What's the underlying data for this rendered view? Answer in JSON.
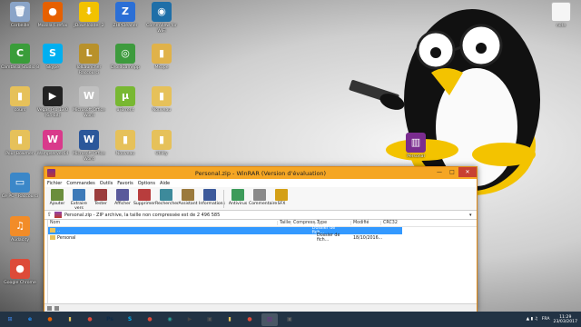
{
  "desktop": {
    "icons": [
      {
        "label": "Corbeille",
        "color": "#8aa4c8",
        "glyph": "🗑",
        "icon": "recycle-bin-icon"
      },
      {
        "label": "Mozilla Firefox",
        "color": "#e66000",
        "glyph": "●",
        "icon": "firefox-icon"
      },
      {
        "label": "JDownloader 2",
        "color": "#f2c200",
        "glyph": "⬇",
        "icon": "jdownloader-icon"
      },
      {
        "label": "ZHPCleaner",
        "color": "#2b6fd6",
        "glyph": "Z",
        "icon": "zhpcleaner-icon"
      },
      {
        "label": "CommView for WiFi",
        "color": "#1f6fa8",
        "glyph": "◉",
        "icon": "commview-icon"
      },
      {
        "label": "Camtasia Studio 8",
        "color": "#3a9d3a",
        "glyph": "C",
        "icon": "camtasia-icon"
      },
      {
        "label": "Skype",
        "color": "#00aff0",
        "glyph": "S",
        "icon": "skype-icon"
      },
      {
        "label": "lolLauncher Raccourci",
        "color": "#b8912b",
        "glyph": "L",
        "icon": "lol-launcher-icon"
      },
      {
        "label": "DroidCamApp",
        "color": "#3d9b3d",
        "glyph": "◎",
        "icon": "droidcam-icon"
      },
      {
        "label": "Mkvpe",
        "color": "#e0b24a",
        "glyph": "▮",
        "icon": "folder-icon"
      },
      {
        "label": "cours",
        "color": "#e6c15a",
        "glyph": "▮",
        "icon": "folder-icon"
      },
      {
        "label": "Vegas Pro 13.0 (64-bit)",
        "color": "#222",
        "glyph": "▶",
        "icon": "vegas-icon"
      },
      {
        "label": "Microsoft Office Word",
        "color": "#c0c0c0",
        "glyph": "W",
        "icon": "word-icon"
      },
      {
        "label": "uTorrent",
        "color": "#78b832",
        "glyph": "µ",
        "icon": "utorrent-icon"
      },
      {
        "label": "Nouveau",
        "color": "#e6c15a",
        "glyph": "▮",
        "icon": "folder-icon"
      },
      {
        "label": "Pour Bowmen",
        "color": "#e6c15a",
        "glyph": "▮",
        "icon": "folder-icon"
      },
      {
        "label": "Wampserver64",
        "color": "#d93a8b",
        "glyph": "W",
        "icon": "wampserver-icon"
      },
      {
        "label": "Microsoft Office Word",
        "color": "#2b579a",
        "glyph": "W",
        "icon": "word-icon"
      },
      {
        "label": "Nouveau",
        "color": "#e6c15a",
        "glyph": "▮",
        "icon": "folder-icon"
      },
      {
        "label": "Utility",
        "color": "#e6c15a",
        "glyph": "▮",
        "icon": "folder-icon"
      },
      {
        "label": "Ce PC - Raccourci",
        "color": "#3b87c8",
        "glyph": "▭",
        "icon": "this-pc-icon"
      },
      {
        "label": "Audacity",
        "color": "#f28c28",
        "glyph": "♫",
        "icon": "audacity-icon"
      },
      {
        "label": "Google Chrome",
        "color": "#dd4b39",
        "glyph": "●",
        "icon": "chrome-icon"
      },
      {
        "label": "Personal",
        "color": "#7a2c8f",
        "glyph": "▥",
        "icon": "winrar-archive-icon"
      },
      {
        "label": "note",
        "color": "#f5f5f5",
        "glyph": "",
        "icon": "note-file-icon"
      }
    ]
  },
  "winrar": {
    "title": "Personal.zip - WinRAR (Version d'évaluation)",
    "menu": [
      "Fichier",
      "Commandes",
      "Outils",
      "Favoris",
      "Options",
      "Aide"
    ],
    "toolbar": [
      {
        "label": "Ajouter",
        "color": "#6b8e3d",
        "icon": "add-icon"
      },
      {
        "label": "Extraire vers",
        "color": "#3d7ab8",
        "icon": "extract-icon"
      },
      {
        "label": "Tester",
        "color": "#9b3d3d",
        "icon": "test-icon"
      },
      {
        "label": "Afficher",
        "color": "#5a5a9b",
        "icon": "view-icon"
      },
      {
        "label": "Supprimer",
        "color": "#b83d3d",
        "icon": "delete-icon"
      },
      {
        "label": "Rechercher",
        "color": "#3d8a9b",
        "icon": "find-icon"
      },
      {
        "label": "Assistant",
        "color": "#9b7a3d",
        "icon": "wizard-icon"
      },
      {
        "label": "Informations",
        "color": "#3d5a9b",
        "icon": "info-icon"
      }
    ],
    "toolbar2": [
      {
        "label": "Antivirus",
        "color": "#3d9b5a",
        "icon": "antivirus-icon"
      },
      {
        "label": "Commentaire",
        "color": "#8a8a8a",
        "icon": "comment-icon"
      },
      {
        "label": "SFX",
        "color": "#d4a017",
        "icon": "sfx-icon"
      }
    ],
    "path": "Personal.zip - ZIP archive, la taille non compressée est de 2 496 585",
    "columns": {
      "name": "Nom",
      "size": "Taille",
      "compressed": "Compress...",
      "type": "Type",
      "modified": "Modifié",
      "crc": "CRC32"
    },
    "rows": [
      {
        "name": "..",
        "size": "",
        "compressed": "",
        "type": "Dossier de fich...",
        "modified": "",
        "crc": ""
      },
      {
        "name": "Personal",
        "size": "",
        "compressed": "",
        "type": "Dossier de fich...",
        "modified": "18/10/2016...",
        "crc": ""
      }
    ]
  },
  "taskbar": {
    "items": [
      {
        "glyph": "⊞",
        "color": "#3a7bd5",
        "icon": "start-icon"
      },
      {
        "glyph": "e",
        "color": "#1e90ff",
        "icon": "ie-icon"
      },
      {
        "glyph": "●",
        "color": "#e66000",
        "icon": "firefox-icon"
      },
      {
        "glyph": "▮",
        "color": "#e6c15a",
        "icon": "explorer-icon"
      },
      {
        "glyph": "●",
        "color": "#dd4b39",
        "icon": "chrome-icon"
      },
      {
        "glyph": "Ps",
        "color": "#0d2b4a",
        "icon": "photoshop-icon"
      },
      {
        "glyph": "S",
        "color": "#00aff0",
        "icon": "skype-icon"
      },
      {
        "glyph": "●",
        "color": "#dd4b39",
        "icon": "chrome-icon"
      },
      {
        "glyph": "◉",
        "color": "#2aa198",
        "icon": "app-icon"
      },
      {
        "glyph": "▶",
        "color": "#444",
        "icon": "media-icon"
      },
      {
        "glyph": "▣",
        "color": "#555",
        "icon": "app-icon"
      },
      {
        "glyph": "▮",
        "color": "#e6c15a",
        "icon": "folder-icon"
      },
      {
        "glyph": "●",
        "color": "#dd4b39",
        "icon": "chrome-icon"
      },
      {
        "glyph": "▥",
        "color": "#7a2c8f",
        "icon": "winrar-icon"
      },
      {
        "glyph": "▣",
        "color": "#666",
        "icon": "app-icon"
      }
    ],
    "lang": "FRA",
    "time": "11:29",
    "date": "23/03/2017"
  }
}
